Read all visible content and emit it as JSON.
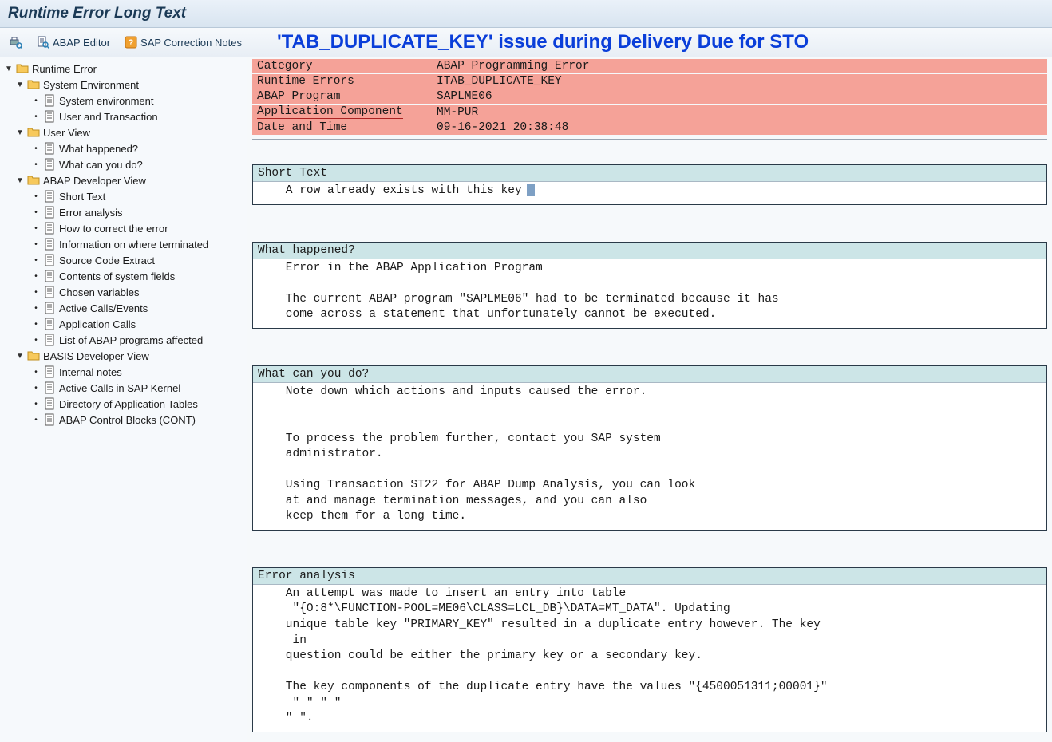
{
  "title": "Runtime Error Long Text",
  "toolbar": {
    "abap_editor": "ABAP Editor",
    "sap_correction_notes": "SAP Correction Notes"
  },
  "overlay_title": "'TAB_DUPLICATE_KEY' issue during Delivery Due for STO",
  "tree": {
    "root": "Runtime Error",
    "sys_env_folder": "System Environment",
    "sys_env": "System environment",
    "user_tx": "User and Transaction",
    "user_view_folder": "User View",
    "what_happened": "What happened?",
    "what_can_you_do": "What can you do?",
    "abap_dev_folder": "ABAP Developer View",
    "short_text": "Short Text",
    "error_analysis": "Error analysis",
    "how_correct": "How to correct the error",
    "where_terminated": "Information on where terminated",
    "source_code_extract": "Source Code Extract",
    "sys_fields": "Contents of system fields",
    "chosen_vars": "Chosen variables",
    "active_calls": "Active Calls/Events",
    "app_calls": "Application Calls",
    "abap_programs_affected": "List of ABAP programs affected",
    "basis_dev_folder": "BASIS Developer View",
    "internal_notes": "Internal notes",
    "kernel_calls": "Active Calls in SAP Kernel",
    "dir_app_tables": "Directory of Application Tables",
    "abap_ctrl_blocks": "ABAP Control Blocks (CONT)"
  },
  "header": {
    "category_label": "Category",
    "category_value": "ABAP Programming Error",
    "runtime_errors_label": "Runtime Errors",
    "runtime_errors_value": "ITAB_DUPLICATE_KEY",
    "abap_program_label": "ABAP Program",
    "abap_program_value": "SAPLME06",
    "app_component_label": "Application Component",
    "app_component_value": "MM-PUR",
    "date_time_label": "Date and Time",
    "date_time_value": "09-16-2021 20:38:48"
  },
  "sections": {
    "short_text_head": "Short Text",
    "short_text_body": "    A row already exists with this key",
    "what_happened_head": "What happened?",
    "what_happened_body": "    Error in the ABAP Application Program\n\n    The current ABAP program \"SAPLME06\" had to be terminated because it has\n    come across a statement that unfortunately cannot be executed.",
    "what_can_you_do_head": "What can you do?",
    "what_can_you_do_body": "    Note down which actions and inputs caused the error.\n\n\n    To process the problem further, contact you SAP system\n    administrator.\n\n    Using Transaction ST22 for ABAP Dump Analysis, you can look\n    at and manage termination messages, and you can also\n    keep them for a long time.",
    "error_analysis_head": "Error analysis",
    "error_analysis_body": "    An attempt was made to insert an entry into table\n     \"{O:8*\\FUNCTION-POOL=ME06\\CLASS=LCL_DB}\\DATA=MT_DATA\". Updating\n    unique table key \"PRIMARY_KEY\" resulted in a duplicate entry however. The key\n     in\n    question could be either the primary key or a secondary key.\n\n    The key components of the duplicate entry have the values \"{4500051311;00001}\"\n     \" \" \" \"\n    \" \"."
  }
}
